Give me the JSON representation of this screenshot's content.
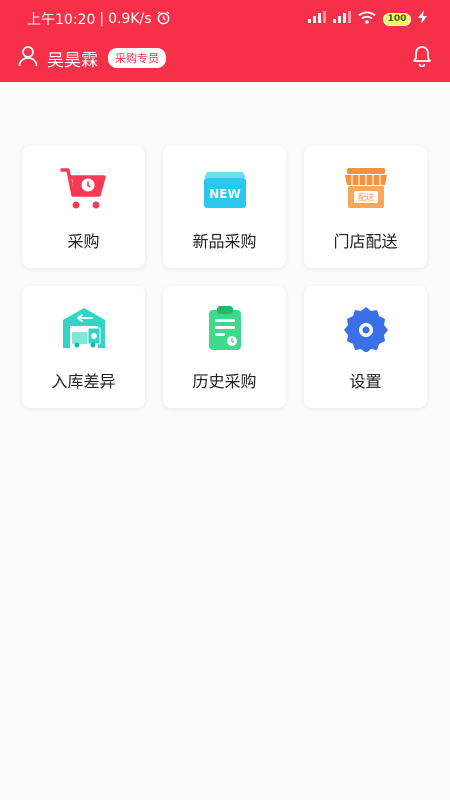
{
  "status_bar": {
    "time": "上午10:20",
    "speed": "0.9K/s",
    "battery": "100"
  },
  "header": {
    "user_name": "吴昊霖",
    "role_badge": "采购专员"
  },
  "menu": [
    {
      "label": "采购",
      "icon": "shopping-cart-icon"
    },
    {
      "label": "新品采购",
      "icon": "new-box-icon",
      "icon_text": "NEW"
    },
    {
      "label": "门店配送",
      "icon": "store-icon",
      "icon_text": "配送"
    },
    {
      "label": "入库差异",
      "icon": "warehouse-truck-icon"
    },
    {
      "label": "历史采购",
      "icon": "clipboard-icon"
    },
    {
      "label": "设置",
      "icon": "gear-icon"
    }
  ],
  "colors": {
    "header": "#f7304a",
    "cart": "#f53a55",
    "new_box": "#2cc7ee",
    "store": "#f5913b",
    "warehouse": "#2fd6c6",
    "clipboard": "#3ed98a",
    "gear": "#3b6fe6"
  }
}
